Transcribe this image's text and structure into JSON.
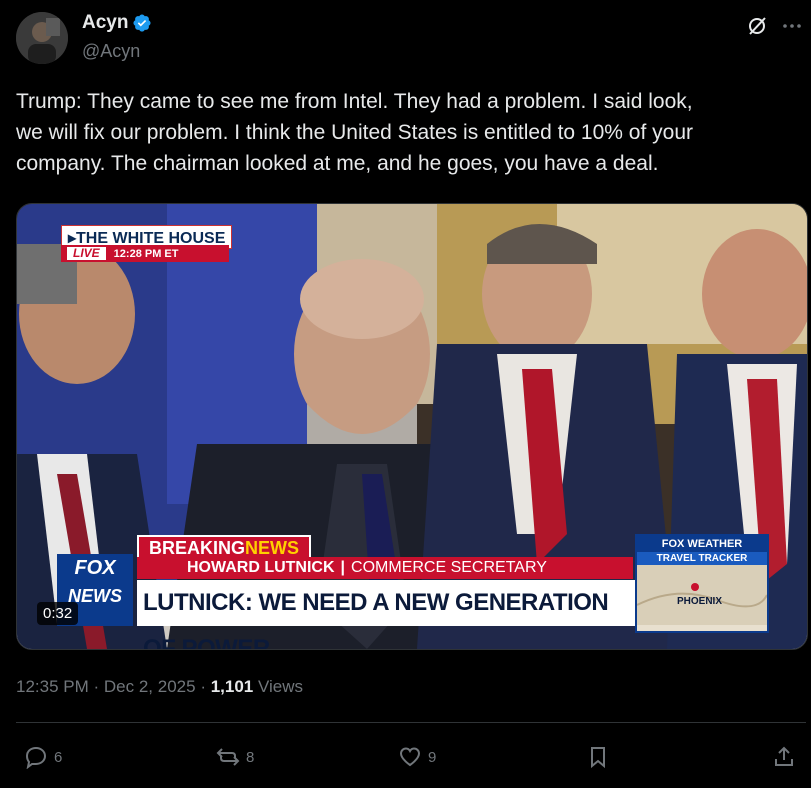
{
  "author": {
    "display_name": "Acyn",
    "handle": "@Acyn",
    "verified": true
  },
  "tweet": {
    "text": "Trump: They came to see me from Intel. They had a problem. I said look,\nwe will fix our problem. I think the United States is entitled to 10% of your\ncompany. The chairman looked at me, and he goes, you have a deal."
  },
  "video": {
    "duration": "0:32",
    "overlay": {
      "corner_tag": "THE WHITE HOUSE",
      "live_label": "LIVE",
      "live_time": "12:28 PM ET",
      "breaking_label": "BREAKING",
      "breaking_news": "NEWS",
      "name": "HOWARD LUTNICK",
      "title": "COMMERCE SECRETARY",
      "headline": "LUTNICK: WE NEED A NEW GENERATION OF POWER",
      "network_line1": "FOX",
      "network_line2": "NEWS",
      "weather_brand": "FOX WEATHER",
      "weather_sub": "TRAVEL TRACKER",
      "weather_city": "PHOENIX"
    }
  },
  "meta": {
    "time": "12:35 PM",
    "date": "Dec 2, 2025",
    "views_count": "1,101",
    "views_label": "Views"
  },
  "actions": {
    "replies": "6",
    "reposts": "8",
    "likes": "9"
  },
  "colors": {
    "background": "#000000",
    "text": "#e7e9ea",
    "muted": "#71767b",
    "verified": "#1d9bf0"
  },
  "icons": [
    "grok-icon",
    "more-icon",
    "verified-badge-icon",
    "reply-icon",
    "repost-icon",
    "like-icon",
    "bookmark-icon",
    "share-icon"
  ]
}
